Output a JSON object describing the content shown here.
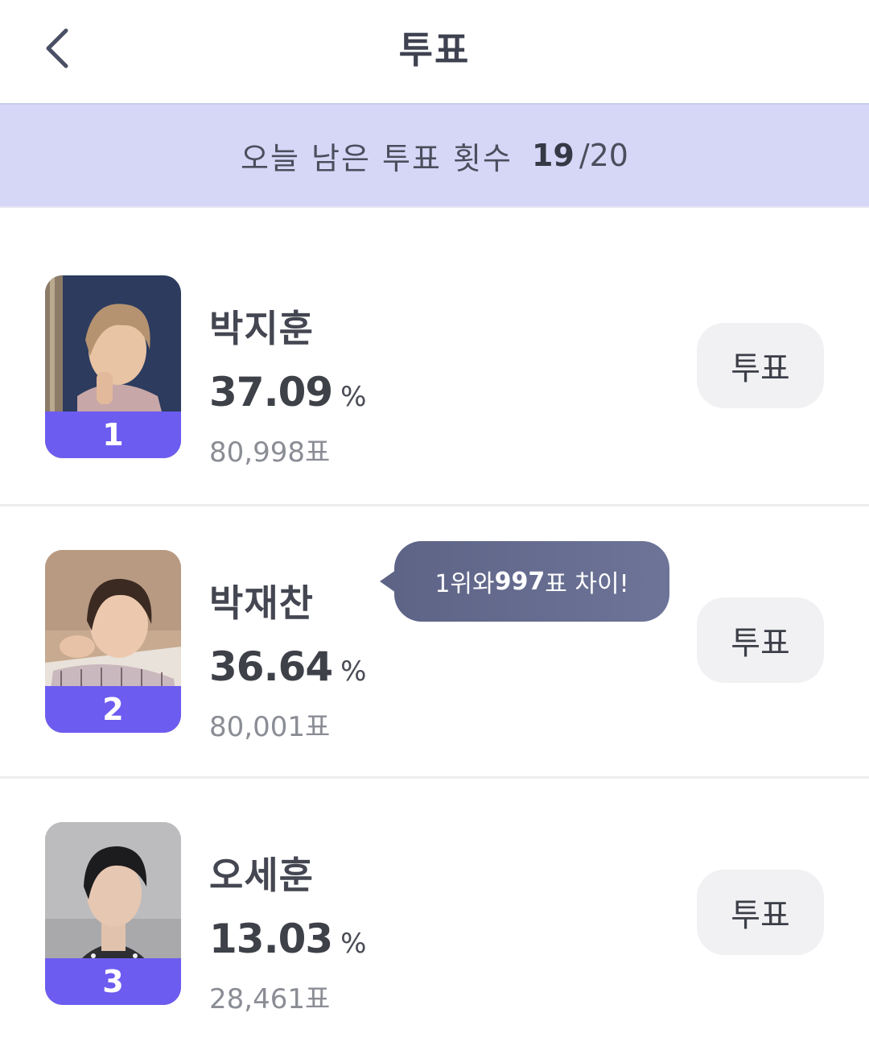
{
  "header": {
    "title": "투표",
    "back_icon": "chevron-left-icon"
  },
  "banner": {
    "label": "오늘 남은 투표 횟수",
    "remaining": "19",
    "total": "/20"
  },
  "candidates": [
    {
      "rank": "1",
      "name": "박지훈",
      "percent": "37.09",
      "percent_unit": "%",
      "votes": "80,998표",
      "vote_button": "투표"
    },
    {
      "rank": "2",
      "name": "박재찬",
      "percent": "36.64",
      "percent_unit": "%",
      "votes": "80,001표",
      "vote_button": "투표"
    },
    {
      "rank": "3",
      "name": "오세훈",
      "percent": "13.03",
      "percent_unit": "%",
      "votes": "28,461표",
      "vote_button": "투표"
    }
  ],
  "tooltip": {
    "prefix": "1위와 ",
    "gap": "997",
    "suffix": "표 차이!"
  },
  "colors": {
    "accent": "#6d5cf0",
    "banner_bg": "#d6d7f7",
    "tooltip_bg": "#656b8f"
  }
}
